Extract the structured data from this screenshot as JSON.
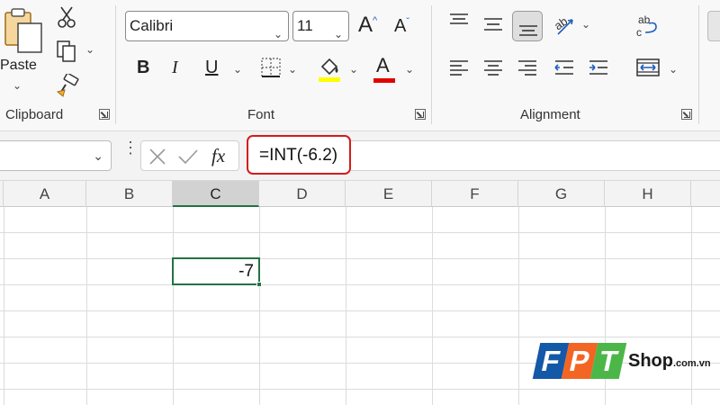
{
  "ribbon": {
    "clipboard": {
      "paste_label": "Paste",
      "group_label": "Clipboard"
    },
    "font": {
      "font_name": "Calibri",
      "font_size": "11",
      "group_label": "Font",
      "highlight_color": "#ffff00",
      "font_color": "#e00000"
    },
    "alignment": {
      "group_label": "Alignment"
    }
  },
  "formula_bar": {
    "name_box_value": "",
    "fx_label": "fx",
    "formula": "=INT(-6.2)"
  },
  "grid": {
    "columns": [
      "A",
      "B",
      "C",
      "D",
      "E",
      "F",
      "G",
      "H"
    ],
    "active_column": "C",
    "active_cell_value": "-7"
  },
  "watermark": {
    "letters": [
      "F",
      "P",
      "T"
    ],
    "brand_text": "Shop",
    "brand_domain": ".com.vn",
    "colors": [
      "#1458a8",
      "#f26522",
      "#4cb748"
    ]
  },
  "colors": {
    "accent_green": "#217346",
    "formula_highlight": "#d41c1c"
  }
}
